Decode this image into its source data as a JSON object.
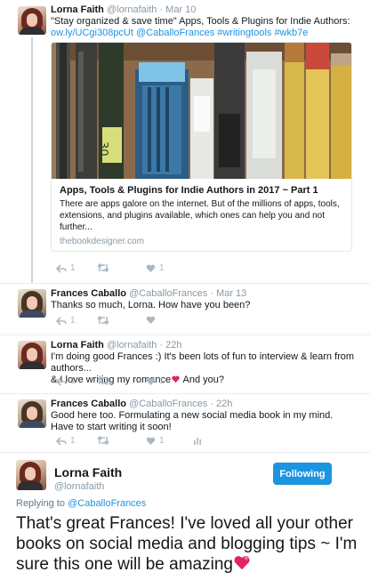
{
  "tweets": [
    {
      "name": "Lorna Faith",
      "handle": "@lornafaith",
      "time": "· Mar 10",
      "text_line1": "\"Stay organized & save time\" Apps, Tools & Plugins for Indie Authors:",
      "link_line": "ow.ly/UCgi308pcUt  @CaballoFrances #writingtools #wkb7e",
      "card": {
        "title": "Apps, Tools & Plugins for Indie Authors in 2017 ~ Part 1",
        "description": "There are apps galore on the internet. But of the millions of apps, tools, extensions, and plugins available, which ones can help you and not further...",
        "domain": "thebookdesigner.com",
        "image_icon": "pens-and-pencils-photo"
      },
      "actions": {
        "reply_count": "1",
        "retweet_count": "",
        "like_count": "1"
      }
    },
    {
      "name": "Frances Caballo",
      "handle": "@CaballoFrances",
      "time": "· Mar 13",
      "text": "Thanks so much, Lorna. How have you been?",
      "actions": {
        "reply_count": "1",
        "retweet_count": "",
        "like_count": ""
      }
    },
    {
      "name": "Lorna Faith",
      "handle": "@lornafaith",
      "time": "· 22h",
      "text_line1": "I'm doing good Frances :) It's been lots of fun to interview & learn from authors...",
      "text_line2": "& I love writing my romance",
      "text_line2_end": " And you?",
      "actions": {
        "reply_count": "1",
        "retweet_count": "",
        "like_count": "1"
      }
    },
    {
      "name": "Frances Caballo",
      "handle": "@CaballoFrances",
      "time": "· 22h",
      "text": "Good here too. Formulating a new social media book in my mind. Have to start writing it soon!",
      "actions": {
        "reply_count": "1",
        "retweet_count": "",
        "like_count": "1"
      }
    }
  ],
  "main_tweet": {
    "name": "Lorna Faith",
    "handle": "@lornafaith",
    "follow_label": "Following",
    "replying_prefix": "Replying to ",
    "replying_to": "@CaballoFrances",
    "text": "That's great Frances! I've loved all your other books on social media and blogging tips ~ I'm sure this one will be amazing"
  },
  "colors": {
    "accent": "#1b95e0",
    "muted": "#8899a6",
    "icon": "#aab8c2",
    "heart": "#e0245e"
  }
}
